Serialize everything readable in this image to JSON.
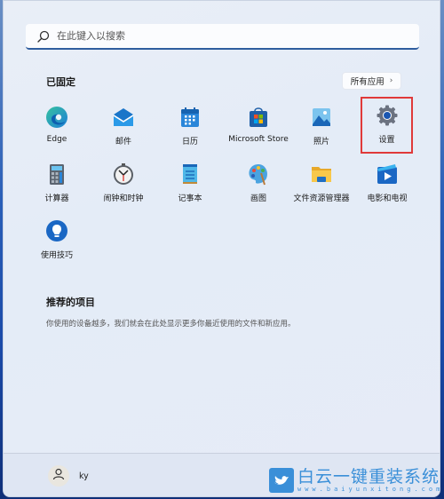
{
  "search": {
    "placeholder": "在此键入以搜索",
    "icon": "search-icon"
  },
  "pinned": {
    "title": "已固定",
    "all_apps_label": "所有应用",
    "all_apps_icon": "chevron-right-icon",
    "apps": [
      {
        "label": "Edge",
        "icon": "edge-icon"
      },
      {
        "label": "邮件",
        "icon": "mail-icon"
      },
      {
        "label": "日历",
        "icon": "calendar-icon"
      },
      {
        "label": "Microsoft Store",
        "icon": "store-icon"
      },
      {
        "label": "照片",
        "icon": "photos-icon"
      },
      {
        "label": "设置",
        "icon": "settings-gear-icon",
        "highlighted": true
      },
      {
        "label": "计算器",
        "icon": "calculator-icon"
      },
      {
        "label": "闹钟和时钟",
        "icon": "clock-icon"
      },
      {
        "label": "记事本",
        "icon": "notepad-icon"
      },
      {
        "label": "画图",
        "icon": "paint-icon"
      },
      {
        "label": "文件资源管理器",
        "icon": "folder-icon"
      },
      {
        "label": "电影和电视",
        "icon": "movies-icon"
      },
      {
        "label": "使用技巧",
        "icon": "tips-lightbulb-icon"
      }
    ]
  },
  "recommended": {
    "title": "推荐的项目",
    "description": "你使用的设备越多，我们就会在此处显示更多你最近使用的文件和新应用。"
  },
  "footer": {
    "username": "ky",
    "avatar_icon": "user-icon"
  },
  "watermark": {
    "title": "白云一键重装系统",
    "url": "www.baiyunxitong.com",
    "icon": "bird-logo-icon"
  },
  "colors": {
    "accent": "#2f5d9e",
    "highlight_box": "#e03a3a",
    "watermark": "#3a8fd8"
  }
}
